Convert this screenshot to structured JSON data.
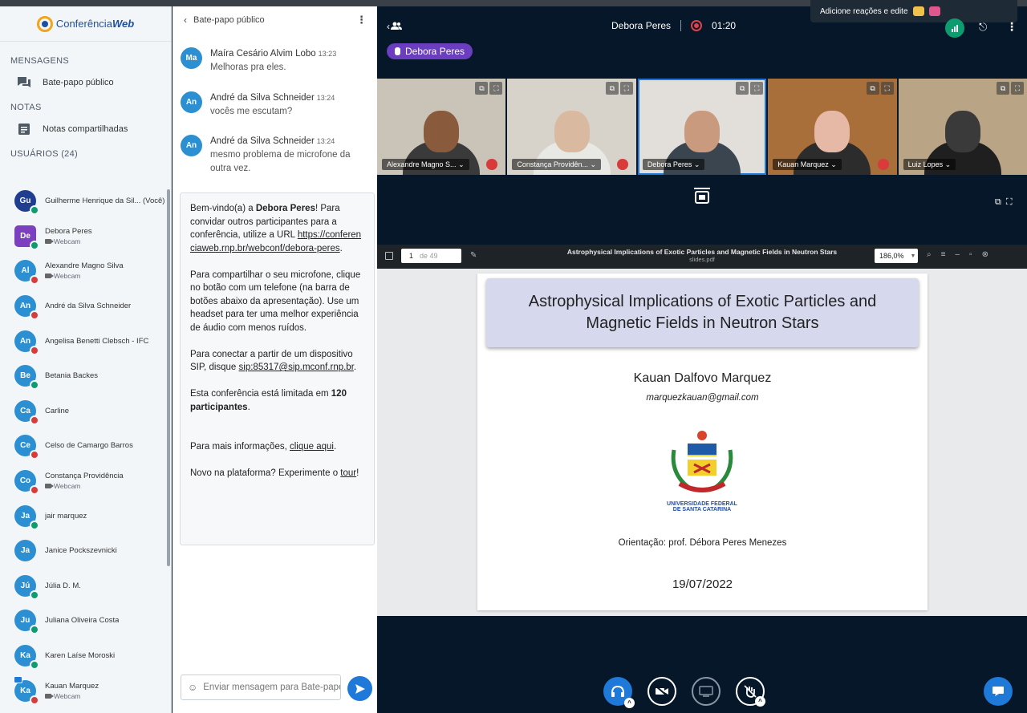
{
  "app": {
    "logo_prefix": "Conferência",
    "logo_suffix": "Web"
  },
  "sidebar": {
    "messages_title": "MENSAGENS",
    "public_chat": "Bate-papo público",
    "notes_title": "NOTAS",
    "shared_notes": "Notas compartilhadas",
    "users_title": "USUÁRIOS  (24)",
    "users": [
      {
        "initials": "Gu",
        "name": "Guilherme Henrique da Sil... (Você)",
        "sub": "",
        "color": "#1f3e8f",
        "badge": "g",
        "square": false
      },
      {
        "initials": "De",
        "name": "Debora Peres",
        "sub": "Webcam",
        "color": "#7b3fbf",
        "badge": "g",
        "square": true
      },
      {
        "initials": "Al",
        "name": "Alexandre Magno Silva",
        "sub": "Webcam",
        "color": "#2b8fd1",
        "badge": "r",
        "square": false
      },
      {
        "initials": "An",
        "name": "André da Silva Schneider",
        "sub": "",
        "color": "#2b8fd1",
        "badge": "r",
        "square": false
      },
      {
        "initials": "An",
        "name": "Angelisa Benetti Clebsch - IFC",
        "sub": "",
        "color": "#2b8fd1",
        "badge": "r",
        "square": false
      },
      {
        "initials": "Be",
        "name": "Betania Backes",
        "sub": "",
        "color": "#2b8fd1",
        "badge": "g",
        "square": false
      },
      {
        "initials": "Ca",
        "name": "Carline",
        "sub": "",
        "color": "#2b8fd1",
        "badge": "r",
        "square": false
      },
      {
        "initials": "Ce",
        "name": "Celso de Camargo Barros",
        "sub": "",
        "color": "#2b8fd1",
        "badge": "r",
        "square": false
      },
      {
        "initials": "Co",
        "name": "Constança Providência",
        "sub": "Webcam",
        "color": "#2b8fd1",
        "badge": "r",
        "square": false
      },
      {
        "initials": "Ja",
        "name": "jair marquez",
        "sub": "",
        "color": "#2b8fd1",
        "badge": "g",
        "square": false
      },
      {
        "initials": "Ja",
        "name": "Janice Pockszevnicki",
        "sub": "",
        "color": "#2b8fd1",
        "badge": "",
        "square": false
      },
      {
        "initials": "Jú",
        "name": "Júlia D. M.",
        "sub": "",
        "color": "#2b8fd1",
        "badge": "g",
        "square": false
      },
      {
        "initials": "Ju",
        "name": "Juliana Oliveira Costa",
        "sub": "",
        "color": "#2b8fd1",
        "badge": "g",
        "square": false
      },
      {
        "initials": "Ka",
        "name": "Karen Laíse Moroski",
        "sub": "",
        "color": "#2b8fd1",
        "badge": "g",
        "square": false
      },
      {
        "initials": "Ka",
        "name": "Kauan Marquez",
        "sub": "Webcam",
        "color": "#2b8fd1",
        "badge": "r",
        "square": false,
        "presenter": true
      }
    ]
  },
  "chat": {
    "header": "Bate-papo público",
    "messages": [
      {
        "initials": "Ma",
        "name": "Maíra Cesário Alvim Lobo",
        "time": "13:23",
        "text": "Melhoras pra eles."
      },
      {
        "initials": "An",
        "name": "André da Silva Schneider",
        "time": "13:24",
        "text": "vocês me escutam?"
      },
      {
        "initials": "An",
        "name": "André da Silva Schneider",
        "time": "13:24",
        "text": "mesmo problema de microfone da outra vez."
      }
    ],
    "welcome": {
      "p1a": "Bem-vindo(a) a ",
      "p1b": "Debora Peres",
      "p1c": "! Para convidar outros participantes para a conferência, utilize a URL ",
      "p1link": "https://conferenciaweb.rnp.br/webconf/debora-peres",
      "p1d": ".",
      "p2": "Para compartilhar o seu microfone, clique no botão com um telefone (na barra de botões abaixo da apresentação). Use um headset para ter uma melhor experiência de áudio com menos ruídos.",
      "p3a": "Para conectar a partir de um dispositivo SIP, disque ",
      "p3link": "sip:85317@sip.mconf.rnp.br",
      "p3b": ".",
      "p4a": "Esta conferência está limitada em ",
      "p4b": "120 participantes",
      "p4c": ".",
      "p5a": "Para mais informações, ",
      "p5link": "clique aqui",
      "p5b": ".",
      "p6a": "Novo na plataforma? Experimente o ",
      "p6link": "tour",
      "p6b": "!"
    },
    "input_placeholder": "Enviar mensagem para Bate-papo público"
  },
  "main": {
    "meeting_name": "Debora Peres",
    "timer": "01:20",
    "toast": "Adicione reações e edite",
    "talking": "Debora Peres",
    "videos": [
      {
        "name": "Alexandre Magno S...",
        "muted": true,
        "bg": "#c9c3b8",
        "face": "#8a5a3c",
        "body": "#3a3a3a",
        "active": false
      },
      {
        "name": "Constança Providên...",
        "muted": true,
        "bg": "#d7d3cb",
        "face": "#d9b9a0",
        "body": "#e8e8e4",
        "active": false
      },
      {
        "name": "Debora Peres",
        "muted": false,
        "bg": "#e2dfda",
        "face": "#c99a7d",
        "body": "#3a4550",
        "active": true
      },
      {
        "name": "Kauan Marquez",
        "muted": true,
        "bg": "#a86f3a",
        "face": "#e6b9a6",
        "body": "#2c2c2c",
        "active": false
      },
      {
        "name": "Luiz Lopes",
        "muted": false,
        "bg": "#b9a485",
        "face": "#3a3a3a",
        "body": "#1f1f1f",
        "active": false
      }
    ],
    "pdf": {
      "page": "1",
      "of": "de 49",
      "title": "Astrophysical Implications of Exotic Particles and Magnetic Fields in Neutron Stars",
      "filename": "slides.pdf",
      "zoom": "186,0%"
    },
    "slide": {
      "title": "Astrophysical Implications of Exotic Particles and Magnetic Fields in Neutron Stars",
      "author": "Kauan Dalfovo Marquez",
      "email": "marquezkauan@gmail.com",
      "university": "UNIVERSIDADE FEDERAL DE SANTA CATARINA",
      "orientation": "Orientação: prof. Débora Peres Menezes",
      "date": "19/07/2022"
    }
  }
}
